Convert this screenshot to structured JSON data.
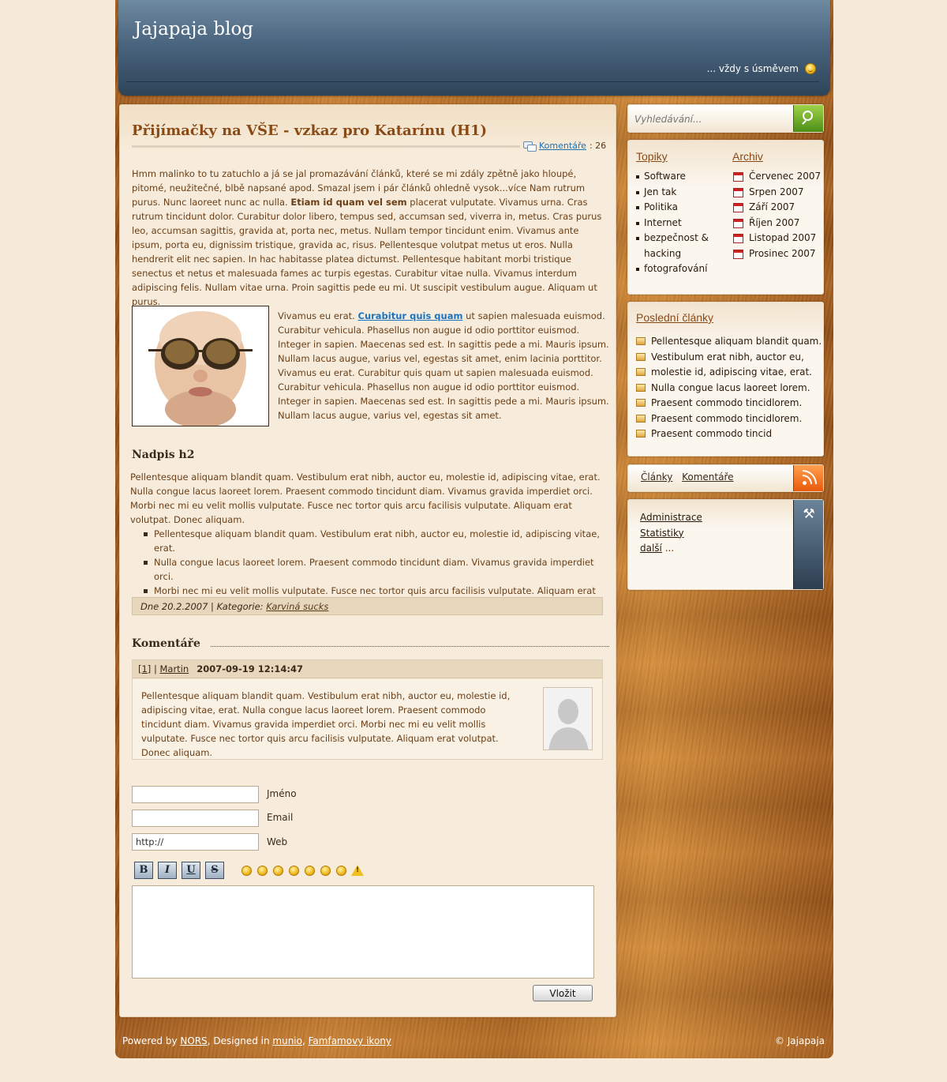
{
  "header": {
    "site_title": "Jajapaja blog",
    "tagline": "... vždy s úsměvem"
  },
  "post": {
    "title": "Přijímačky na VŠE - vzkaz pro Katarínu (H1)",
    "comments_link": "Komentáře",
    "comments_count": ": 26",
    "p1_a": "Hmm malinko to tu zatuchlo a já se jal promazávání článků, které se mi zdály zpětně jako hloupé, pitomé, neužitečné, blbě napsané apod. Smazal jsem i pár článků ohledně vysok...více Nam rutrum purus. Nunc laoreet nunc ac nulla. ",
    "p1_bold": "Etiam id quam vel sem",
    "p1_b": " placerat vulputate. Vivamus urna. Cras rutrum tincidunt dolor. Curabitur dolor libero, tempus sed, accumsan sed, viverra in, metus. Cras purus leo, accumsan sagittis, gravida at, porta nec, metus. Nullam tempor tincidunt enim. Vivamus ante ipsum, porta eu, dignissim tristique, gravida ac, risus. Pellentesque volutpat metus ut eros. Nulla hendrerit elit nec sapien. In hac habitasse platea dictumst. Pellentesque habitant morbi tristique senectus et netus et malesuada fames ac turpis egestas. Curabitur vitae nulla. Vivamus interdum adipiscing felis. Nullam vitae urna. Proin sagittis pede eu mi. Ut suscipit vestibulum augue. Aliquam ut purus.",
    "p2_a": "Vivamus eu erat. ",
    "p2_link": "Curabitur quis quam",
    "p2_b": " ut sapien malesuada euismod. Curabitur vehicula. Phasellus non augue id odio porttitor euismod. Integer in sapien. Maecenas sed est. In sagittis pede a mi. Mauris ipsum. Nullam lacus augue, varius vel, egestas sit amet, enim lacinia porttitor. Vivamus eu erat. Curabitur quis quam ut sapien malesuada euismod. Curabitur vehicula. Phasellus non augue id odio porttitor euismod. Integer in sapien. Maecenas sed est. In sagittis pede a mi. Mauris ipsum. Nullam lacus augue, varius vel, egestas sit amet.",
    "h2": "Nadpis h2",
    "p3": "Pellentesque aliquam blandit quam. Vestibulum erat nibh, auctor eu, molestie id, adipiscing vitae, erat. Nulla congue lacus laoreet lorem. Praesent commodo tincidunt diam. Vivamus gravida imperdiet orci. Morbi nec mi eu velit mollis vulputate. Fusce nec tortor quis arcu facilisis vulputate. Aliquam erat volutpat. Donec aliquam.",
    "bullets": [
      "Pellentesque aliquam blandit quam. Vestibulum erat nibh, auctor eu, molestie id, adipiscing vitae, erat.",
      "Nulla congue lacus laoreet lorem. Praesent commodo tincidunt diam. Vivamus gravida imperdiet orci.",
      "Morbi nec mi eu velit mollis vulputate. Fusce nec tortor quis arcu facilisis vulputate. Aliquam erat volutpat. Donec aliquam."
    ],
    "meta_date": "Dne 20.2.2007 | Kategorie: ",
    "meta_category": "Karviná sucks"
  },
  "comments": {
    "heading": "Komentáře",
    "items": [
      {
        "num": "[1]",
        "sep": " | ",
        "author": "Martin",
        "date": "2007-09-19 12:14:47",
        "text": "Pellentesque aliquam blandit quam. Vestibulum erat nibh, auctor eu, molestie id, adipiscing vitae, erat. Nulla congue lacus laoreet lorem. Praesent commodo tincidunt diam. Vivamus gravida imperdiet orci. Morbi nec mi eu velit mollis vulputate. Fusce nec tortor quis arcu facilisis vulputate. Aliquam erat volutpat. Donec aliquam."
      }
    ]
  },
  "form": {
    "name_label": "Jméno",
    "email_label": "Email",
    "web_label": "Web",
    "web_value": "http://",
    "bold": "B",
    "italic": "I",
    "underline": "U",
    "strike": "S",
    "submit": "Vložit"
  },
  "sidebar": {
    "search_placeholder": "Vyhledávání...",
    "topics_heading": "Topiky",
    "topics": [
      "Software",
      "Jen tak",
      "Politika",
      "Internet",
      "bezpečnost & hacking",
      "fotografování"
    ],
    "archive_heading": "Archiv",
    "archive": [
      "Červenec 2007",
      "Srpen 2007",
      "Září 2007",
      "Říjen 2007",
      "Listopad 2007",
      "Prosinec 2007"
    ],
    "recent_heading": "Poslední články",
    "recent": [
      "Pellentesque aliquam blandit quam.",
      "Vestibulum erat nibh, auctor eu,",
      "molestie id, adipiscing vitae, erat.",
      "Nulla congue lacus laoreet lorem.",
      "Praesent commodo tincidlorem.",
      "Praesent commodo tincidlorem.",
      "Praesent commodo tincid"
    ],
    "rss_articles": "Články",
    "rss_comments": "Komentáře",
    "admin": "Administrace",
    "stats": "Statistiky",
    "more": "další",
    "more_suffix": " ..."
  },
  "footer": {
    "powered": "Powered by ",
    "nors": "NORS",
    "designed": ", Designed in ",
    "munio": "munio",
    "comma": ", ",
    "famfamfam": "Famfamovy ikony",
    "copyright": "© Jajapaja"
  },
  "colors": {
    "header_blue": "#4b6580",
    "wood": "#a55e1c",
    "page_bg": "#f8ead8",
    "title_brown": "#8a4a16",
    "link_blue": "#1d73c0",
    "search_green": "#6bac2a",
    "rss_orange": "#f57a20"
  }
}
